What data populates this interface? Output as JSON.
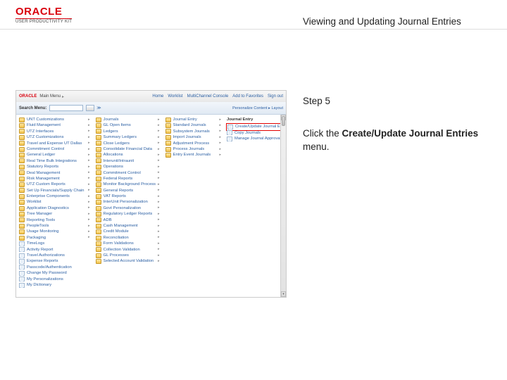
{
  "header": {
    "brand_main": "ORACLE",
    "brand_sub": "USER PRODUCTIVITY KIT",
    "page_title": "Viewing and Updating Journal Entries"
  },
  "instructions": {
    "step_label": "Step 5",
    "click_prefix": "Click the ",
    "click_bold": "Create/Update Journal Entries",
    "click_suffix": " menu."
  },
  "screenshot": {
    "brand": "ORACLE",
    "top_label": "Main Menu",
    "nav_links": [
      "Home",
      "Worklist",
      "MultiChannel Console",
      "Add to Favorites",
      "Sign out"
    ],
    "search_label": "Search Menu:",
    "crumb": "Personalize Content ▸ Layout",
    "col1": [
      {
        "icon": "folder",
        "label": "UNT Customizations",
        "arrow": true
      },
      {
        "icon": "folder",
        "label": "Fluid Management",
        "arrow": true
      },
      {
        "icon": "folder",
        "label": "UTZ Interfaces",
        "arrow": true
      },
      {
        "icon": "folder",
        "label": "UTZ Customizations",
        "arrow": true
      },
      {
        "icon": "folder",
        "label": "Travel and Expense UT Dallas",
        "arrow": true
      },
      {
        "icon": "folder",
        "label": "Commitment Control",
        "arrow": true
      },
      {
        "icon": "folder",
        "label": "General Ledger",
        "arrow": true
      },
      {
        "icon": "folder",
        "label": "Real Time Bulk Integrations",
        "arrow": true
      },
      {
        "icon": "folder",
        "label": "Statutory Reports",
        "arrow": true
      },
      {
        "icon": "folder",
        "label": "Deal Management",
        "arrow": true
      },
      {
        "icon": "folder",
        "label": "Risk Management",
        "arrow": true
      },
      {
        "icon": "folder",
        "label": "UTZ Custom Reports",
        "arrow": true
      },
      {
        "icon": "folder",
        "label": "Set Up Financials/Supply Chain",
        "arrow": true
      },
      {
        "icon": "folder",
        "label": "Enterprise Components",
        "arrow": true
      },
      {
        "icon": "folder",
        "label": "Worklist",
        "arrow": true
      },
      {
        "icon": "folder",
        "label": "Application Diagnostics",
        "arrow": true
      },
      {
        "icon": "folder",
        "label": "Tree Manager",
        "arrow": true
      },
      {
        "icon": "folder",
        "label": "Reporting Tools",
        "arrow": true
      },
      {
        "icon": "folder",
        "label": "PeopleTools",
        "arrow": true
      },
      {
        "icon": "folder",
        "label": "Usage Monitoring",
        "arrow": true
      },
      {
        "icon": "folder",
        "label": "Packaging",
        "arrow": true
      },
      {
        "icon": "page",
        "label": "TimeLogs",
        "arrow": false
      },
      {
        "icon": "page",
        "label": "Activity Report",
        "arrow": false
      },
      {
        "icon": "page",
        "label": "Travel Authorizations",
        "arrow": false
      },
      {
        "icon": "page",
        "label": "Expense Reports",
        "arrow": false
      },
      {
        "icon": "page",
        "label": "Passcode/Authentication",
        "arrow": false
      },
      {
        "icon": "page",
        "label": "Change My Password",
        "arrow": false
      },
      {
        "icon": "page",
        "label": "My Personalizations",
        "arrow": false
      },
      {
        "icon": "page",
        "label": "My Dictionary",
        "arrow": false
      }
    ],
    "col2": [
      {
        "icon": "folder",
        "label": "Journals",
        "arrow": true
      },
      {
        "icon": "folder",
        "label": "GL Open Items",
        "arrow": true
      },
      {
        "icon": "folder",
        "label": "Ledgers",
        "arrow": true
      },
      {
        "icon": "folder",
        "label": "Summary Ledgers",
        "arrow": true
      },
      {
        "icon": "folder",
        "label": "Close Ledgers",
        "arrow": true
      },
      {
        "icon": "folder",
        "label": "Consolidate Financial Data",
        "arrow": true
      },
      {
        "icon": "folder",
        "label": "Allocations",
        "arrow": true
      },
      {
        "icon": "folder",
        "label": "Interunit/Intraunit",
        "arrow": true
      },
      {
        "icon": "folder",
        "label": "Operations",
        "arrow": true
      },
      {
        "icon": "folder",
        "label": "Commitment Control",
        "arrow": true
      },
      {
        "icon": "folder",
        "label": "Federal Reports",
        "arrow": true
      },
      {
        "icon": "folder",
        "label": "Monitor Background Process",
        "arrow": true
      },
      {
        "icon": "folder",
        "label": "General Reports",
        "arrow": true
      },
      {
        "icon": "folder",
        "label": "VAT Reports",
        "arrow": true
      },
      {
        "icon": "folder",
        "label": "InterUnit Personalization",
        "arrow": true
      },
      {
        "icon": "folder",
        "label": "Govt Personalization",
        "arrow": true
      },
      {
        "icon": "folder",
        "label": "Regulatory Ledger Reports",
        "arrow": true
      },
      {
        "icon": "folder",
        "label": "ADB",
        "arrow": true
      },
      {
        "icon": "folder",
        "label": "Cash Management",
        "arrow": true
      },
      {
        "icon": "folder",
        "label": "Credit Module",
        "arrow": true
      },
      {
        "icon": "folder",
        "label": "Reconciliation",
        "arrow": true
      },
      {
        "icon": "folder",
        "label": "Form Validations",
        "arrow": true
      },
      {
        "icon": "folder",
        "label": "Collection Validation",
        "arrow": true
      },
      {
        "icon": "folder",
        "label": "GL Processes",
        "arrow": true
      },
      {
        "icon": "folder",
        "label": "Selected Account Validation",
        "arrow": true
      }
    ],
    "col3": [
      {
        "icon": "folder",
        "label": "Journal Entry",
        "arrow": true
      },
      {
        "icon": "folder",
        "label": "Standard Journals",
        "arrow": true
      },
      {
        "icon": "folder",
        "label": "Subsystem Journals",
        "arrow": true
      },
      {
        "icon": "folder",
        "label": "Import Journals",
        "arrow": true
      },
      {
        "icon": "folder",
        "label": "Adjustment Process",
        "arrow": true
      },
      {
        "icon": "folder",
        "label": "Process Journals",
        "arrow": true
      },
      {
        "icon": "folder",
        "label": "Entry Event Journals",
        "arrow": true
      }
    ],
    "col4_heading": "Journal Entry",
    "col4": [
      {
        "icon": "page",
        "label": "Create/Update Journal Entries",
        "highlight": true
      },
      {
        "icon": "page",
        "label": "Copy Journals"
      },
      {
        "icon": "page",
        "label": "Manage Journal Approval"
      }
    ]
  }
}
